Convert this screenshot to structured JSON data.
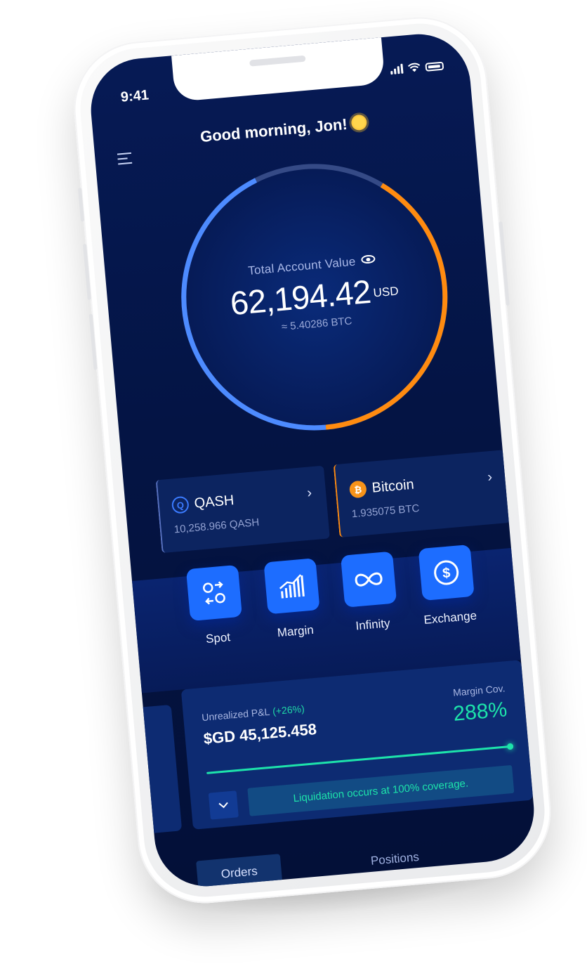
{
  "status_bar": {
    "time": "9:41"
  },
  "header": {
    "greeting": "Good morning, Jon!",
    "greeting_icon": "sun-emoji-icon",
    "menu_icon": "menu-icon"
  },
  "account": {
    "label": "Total Account Value",
    "value": "62,194.42",
    "currency": "USD",
    "btc_equivalent": "≈ 5.40286 BTC",
    "allocation": [
      {
        "asset": "QASH",
        "fraction": 0.55,
        "color": "#4d8bff"
      },
      {
        "asset": "Bitcoin",
        "fraction": 0.45,
        "color": "#ff8b10"
      }
    ]
  },
  "assets": [
    {
      "name": "QASH",
      "amount": "10,258.966 QASH",
      "icon": "qash-icon",
      "accent": "#5a73c2"
    },
    {
      "name": "Bitcoin",
      "amount": "1.935075 BTC",
      "icon": "bitcoin-icon",
      "accent": "#ff8b10"
    }
  ],
  "actions": [
    {
      "label": "Spot",
      "icon": "swap-icon"
    },
    {
      "label": "Margin",
      "icon": "bar-chart-icon"
    },
    {
      "label": "Infinity",
      "icon": "infinity-icon"
    },
    {
      "label": "Exchange",
      "icon": "dollar-coin-icon"
    }
  ],
  "pl": {
    "label": "Unrealized P&L",
    "change": "(+26%)",
    "value": "$GD 45,125.458",
    "margin_cov_label": "Margin Cov.",
    "margin_cov_value": "288%",
    "progress_fraction": 1.0,
    "notice": "Liquidation occurs at 100% coverage."
  },
  "tabs": [
    {
      "label": "Orders",
      "active": true
    },
    {
      "label": "Positions",
      "active": false
    }
  ],
  "colors": {
    "accent": "#1d6dff",
    "success": "#1de3aa",
    "bitcoin": "#f7931a",
    "background": "#041444"
  }
}
